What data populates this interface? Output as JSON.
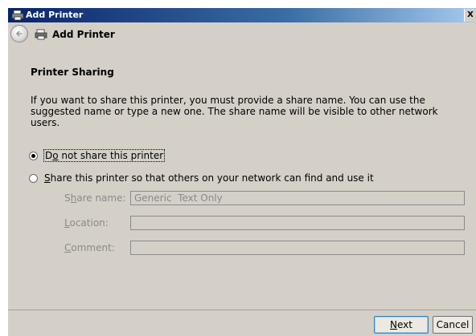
{
  "window": {
    "title": "Add Printer",
    "close_glyph": "X"
  },
  "nav": {
    "title": "Add Printer",
    "back_icon": "back-arrow-icon",
    "printer_icon": "printer-icon"
  },
  "page": {
    "section_title": "Printer Sharing",
    "description": "If you want to share this printer, you must provide a share name. You can use the suggested name or type a new one. The share name will be visible to other network users."
  },
  "options": {
    "no_share": {
      "pre": "D",
      "accel": "o",
      "post": " not share this printer",
      "checked": true
    },
    "share": {
      "pre": "",
      "accel": "S",
      "post": "hare this printer so that others on your network can find and use it",
      "checked": false
    }
  },
  "fields": {
    "share_name": {
      "pre": "S",
      "accel": "h",
      "post": "are name:",
      "value": "Generic  Text Only",
      "enabled": false
    },
    "location": {
      "pre": "",
      "accel": "L",
      "post": "ocation:",
      "value": "",
      "enabled": false
    },
    "comment": {
      "pre": "",
      "accel": "C",
      "post": "omment:",
      "value": "",
      "enabled": false
    }
  },
  "buttons": {
    "next": {
      "accel": "N",
      "post": "ext"
    },
    "cancel": {
      "label": "Cancel"
    }
  },
  "colors": {
    "titlebar_start": "#0a246a",
    "background": "#d4d0c8",
    "disabled_text": "#8a8a8a"
  }
}
